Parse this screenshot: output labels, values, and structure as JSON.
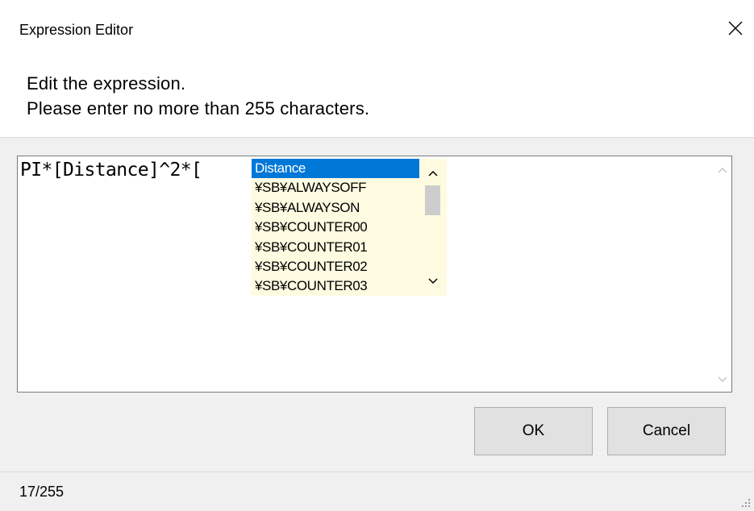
{
  "window": {
    "title": "Expression Editor",
    "close_icon": "close-icon"
  },
  "header": {
    "line1": "Edit the expression.",
    "line2": "Please enter no more than 255 characters."
  },
  "editor": {
    "value": "PI*[Distance]^2*["
  },
  "autocomplete": {
    "items": [
      "Distance",
      "¥SB¥ALWAYSOFF",
      "¥SB¥ALWAYSON",
      "¥SB¥COUNTER00",
      "¥SB¥COUNTER01",
      "¥SB¥COUNTER02",
      "¥SB¥COUNTER03"
    ],
    "selected_index": 0,
    "selected_color": "#0078d7",
    "background_color": "#fffbe1"
  },
  "buttons": {
    "ok_label": "OK",
    "cancel_label": "Cancel"
  },
  "status": {
    "char_count": "17/255"
  }
}
